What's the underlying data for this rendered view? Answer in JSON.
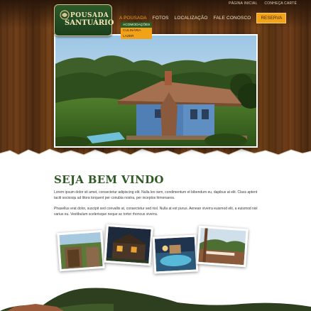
{
  "top_links": [
    "PÁGINA INICIAL",
    "CONHEÇA CARTÉ"
  ],
  "logo": {
    "line1": "POUSADA",
    "line2": "SANTUÁRIO"
  },
  "nav": {
    "items": [
      "A POUSADA",
      "FOTOS",
      "LOCALIZAÇÃO",
      "FALE CONOSCO"
    ],
    "active": "A POUSADA",
    "cta": "RESERVA"
  },
  "dropdown": [
    "ACOMODAÇÕES",
    "CULINÁRIA",
    "LAZER"
  ],
  "welcome": {
    "title": "SEJA BEM VINDO",
    "paragraph1": "Lorem ipsum dolor sit amet, consectetur adipiscing elit. Nulla leo sem, condimentum et bibendum eu, dapibus at elit. Class aptent taciti sociosqu ad litora torquent per conubia nostra, per inceptos himenaeos.",
    "paragraph2": "Phasellus erat dolor, suscipit sed convallis at, consectetur sed nisl. Nulla at est purus. Aenean viverra euismod elit, a euismod nisl varius eu. Vestibulum scelerisque neque ac tortor rhoncus viverra."
  },
  "colors": {
    "accent": "#f0a41a",
    "brand_green": "#2e5a24",
    "wood": "#5e3414"
  },
  "icons": [
    "logo-ornament-icon"
  ]
}
